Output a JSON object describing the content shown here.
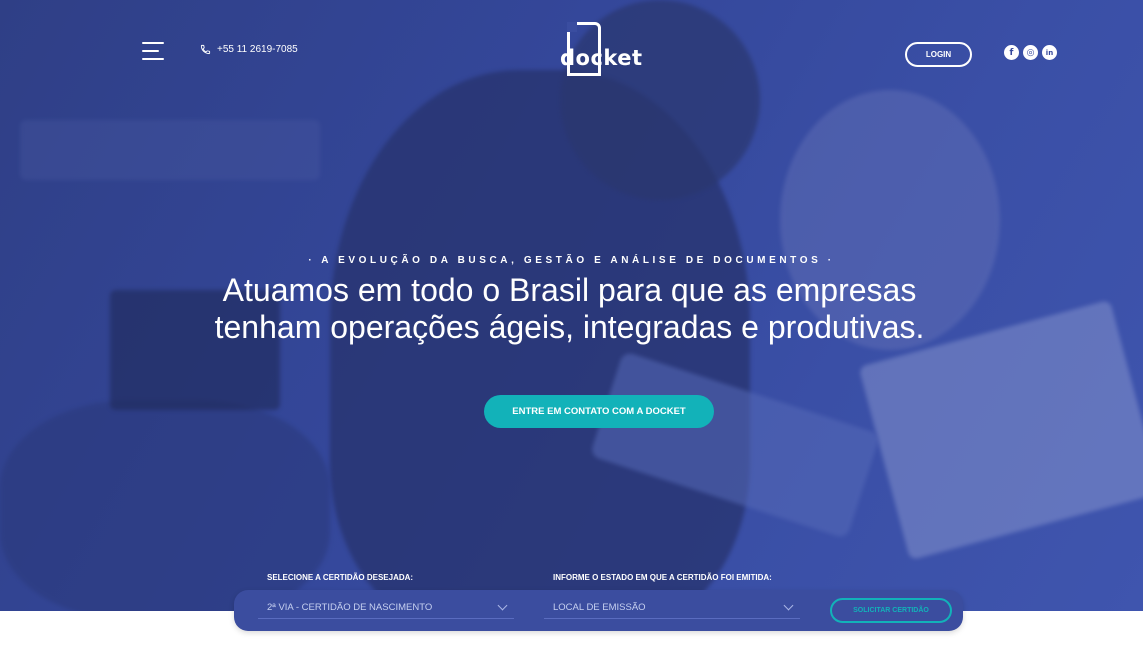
{
  "header": {
    "phone": "+55 11 2619-7085",
    "logo_text": "docket",
    "login_label": "LOGIN",
    "social": [
      {
        "name": "facebook-icon",
        "glyph": "f"
      },
      {
        "name": "instagram-icon",
        "glyph": "◎"
      },
      {
        "name": "linkedin-icon",
        "glyph": "in"
      }
    ]
  },
  "hero": {
    "eyebrow": "·  A EVOLUÇÃO DA BUSCA, GESTÃO E ANÁLISE DE DOCUMENTOS  ·",
    "headline_line1": "Atuamos em todo o Brasil para que as empresas",
    "headline_line2": "tenham operações ágeis, integradas e produtivas.",
    "cta_label": "ENTRE EM CONTATO COM A DOCKET"
  },
  "form": {
    "certificate_label": "SELECIONE A CERTIDÃO DESEJADA:",
    "certificate_value": "2ª VIA - CERTIDÃO DE NASCIMENTO",
    "state_label": "INFORME O ESTADO EM QUE A CERTIDÃO FOI EMITIDA:",
    "state_value": "LOCAL DE EMISSÃO",
    "submit_label": "SOLICITAR CERTIDÃO"
  },
  "colors": {
    "hero_overlay": "#34479a",
    "accent": "#12b2b9",
    "white": "#ffffff"
  }
}
